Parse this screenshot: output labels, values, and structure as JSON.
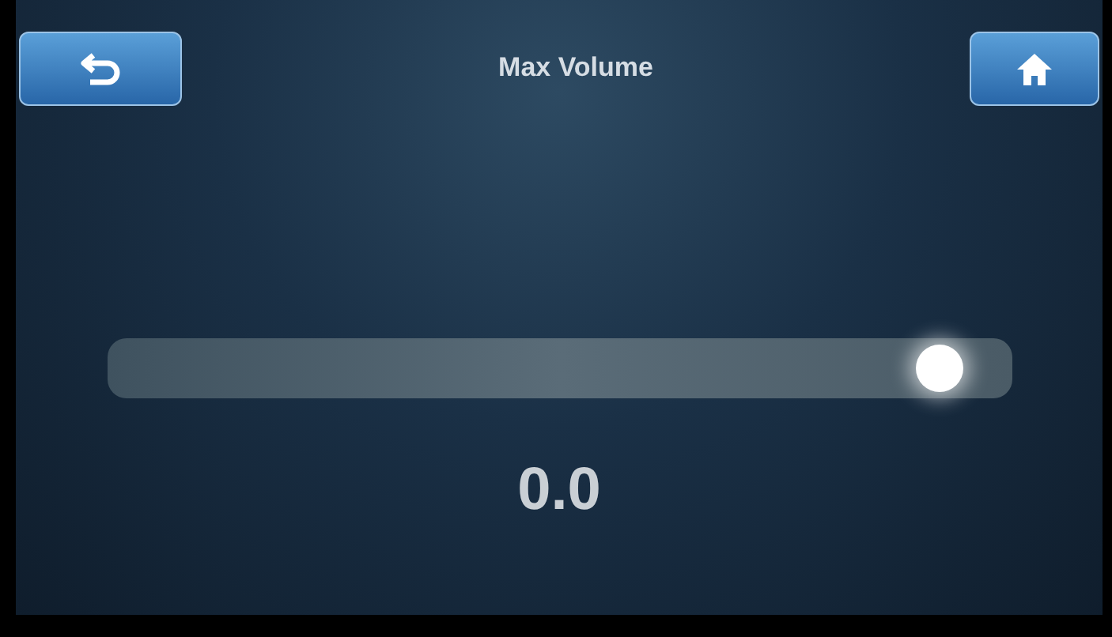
{
  "header": {
    "title": "Max Volume"
  },
  "slider": {
    "level": 0.92
  },
  "value": "0.0"
}
